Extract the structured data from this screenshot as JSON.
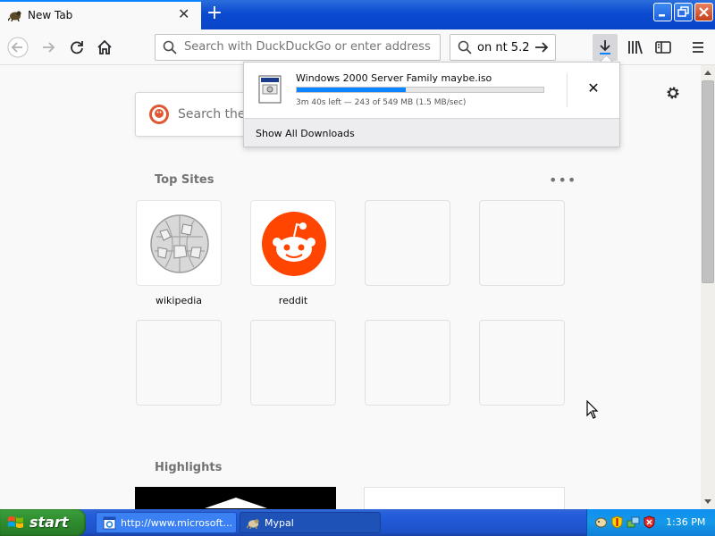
{
  "browser": {
    "tab": {
      "title": "New Tab"
    },
    "url_bar": {
      "placeholder": "Search with DuckDuckGo or enter address"
    },
    "search_box": {
      "text": "on nt 5.2"
    }
  },
  "downloads_panel": {
    "filename": "Windows 2000 Server Family maybe.iso",
    "progress": 0.443,
    "status": "3m 40s left — 243 of 549 MB (1.5 MB/sec)",
    "show_all_label": "Show All Downloads"
  },
  "newtab": {
    "search_placeholder": "Search the Web",
    "top_sites_title": "Top Sites",
    "top_sites": [
      {
        "label": "wikipedia"
      },
      {
        "label": "reddit"
      }
    ],
    "highlights_title": "Highlights"
  },
  "taskbar": {
    "start_label": "start",
    "tasks": [
      {
        "label": "http://www.microsoft..."
      },
      {
        "label": "Mypal"
      }
    ],
    "clock": "1:36 PM"
  },
  "colors": {
    "accent": "#0a84ff",
    "xp_title_blue": "#0a4ad0",
    "start_green": "#2e8b2e",
    "reddit_orange": "#ff4500",
    "duckduckgo_orange": "#de5833"
  }
}
